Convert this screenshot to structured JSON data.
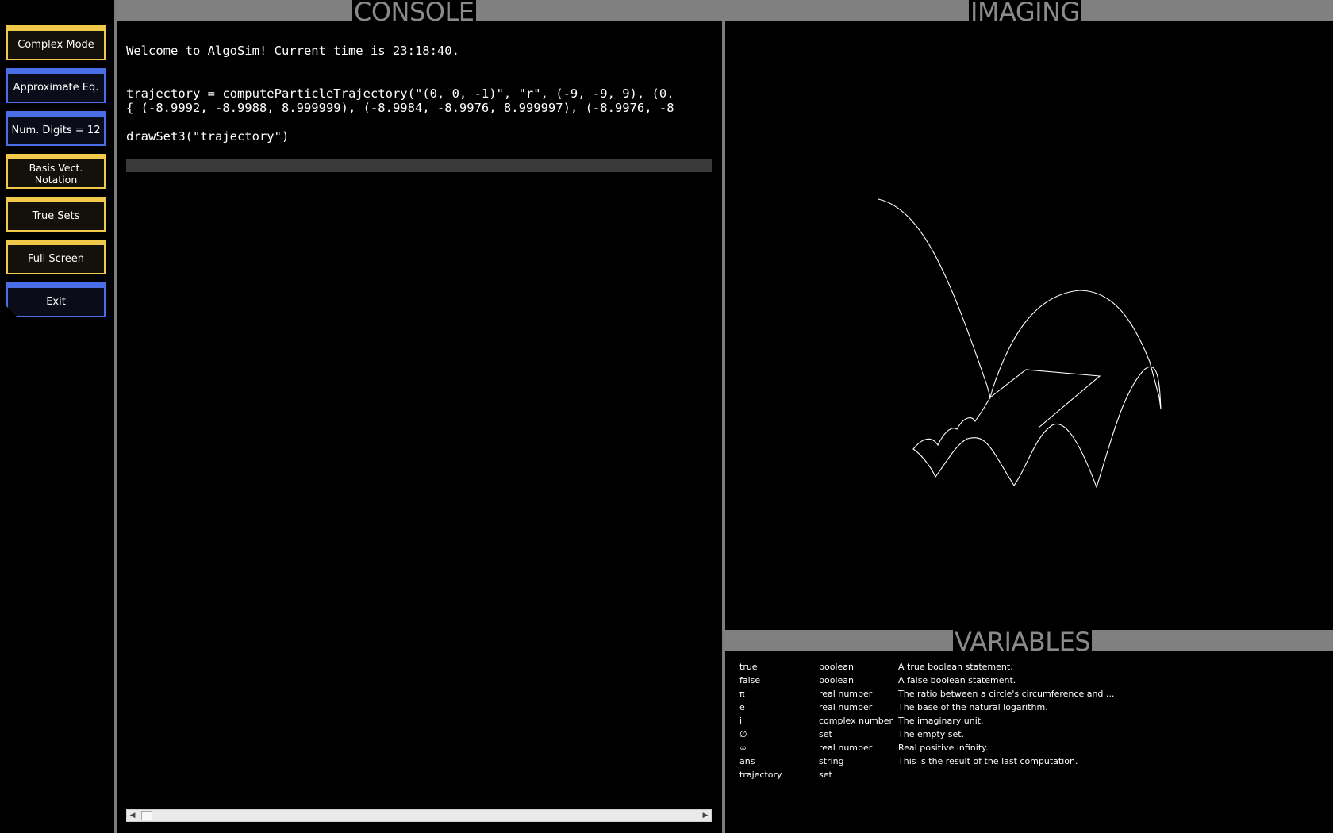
{
  "sidebar": {
    "buttons": [
      {
        "label": "Complex Mode",
        "color": "#f0c84a"
      },
      {
        "label": "Approximate Eq.",
        "color": "#4a6ee8"
      },
      {
        "label": "Num. Digits = 12",
        "color": "#4a6ee8"
      },
      {
        "label": "Basis Vect. Notation",
        "color": "#f0c84a"
      },
      {
        "label": "True Sets",
        "color": "#f0c84a"
      },
      {
        "label": "Full Screen",
        "color": "#f0c84a"
      },
      {
        "label": "Exit",
        "color": "#4a6ee8"
      }
    ]
  },
  "console": {
    "title": "CONSOLE",
    "lines": [
      "Welcome to AlgoSim! Current time is 23:18:40.",
      "trajectory = computeParticleTrajectory(\"(0, 0, -1)\", \"r\", (-9, -9, 9), (0.",
      "{ (-8.9992, -8.9988, 8.999999), (-8.9984, -8.9976, 8.999997), (-8.9976, -8",
      "drawSet3(\"trajectory\")"
    ]
  },
  "imaging": {
    "title": "IMAGING"
  },
  "variables": {
    "title": "VARIABLES",
    "rows": [
      {
        "name": "true",
        "type": "boolean",
        "description": "A true boolean statement."
      },
      {
        "name": "false",
        "type": "boolean",
        "description": "A false boolean statement."
      },
      {
        "name": "π",
        "type": "real number",
        "description": "The ratio between a circle's circumference and ..."
      },
      {
        "name": "e",
        "type": "real number",
        "description": "The base of the natural logarithm."
      },
      {
        "name": "i",
        "type": "complex number",
        "description": "The imaginary unit."
      },
      {
        "name": "∅",
        "type": "set",
        "description": "The empty set."
      },
      {
        "name": "∞",
        "type": "real number",
        "description": "Real positive infinity."
      },
      {
        "name": "ans",
        "type": "string",
        "description": "This is the result of the last computation."
      },
      {
        "name": "trajectory",
        "type": "set",
        "description": ""
      }
    ]
  },
  "colors": {
    "title_bar": "#808080",
    "title_text": "#8a8a8a",
    "accent_yellow": "#f0c84a",
    "accent_blue": "#4a6ee8"
  }
}
